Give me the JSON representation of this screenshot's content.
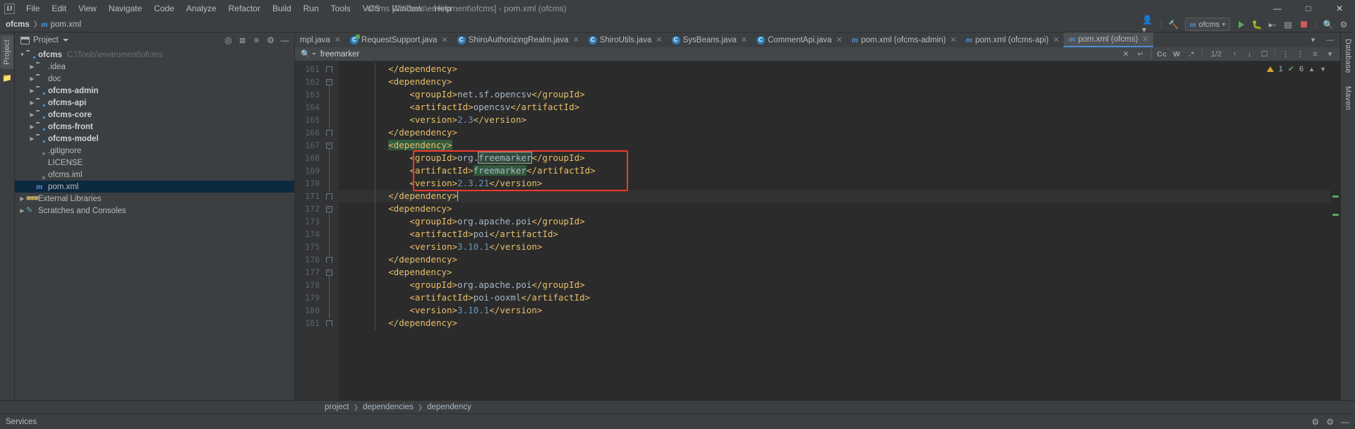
{
  "titlebar": {
    "logo": "IJ",
    "window_title": "ofcms [C:\\Tools\\enviroment\\ofcms] - pom.xml (ofcms)",
    "menu": [
      {
        "label": "File"
      },
      {
        "label": "Edit"
      },
      {
        "label": "View"
      },
      {
        "label": "Navigate"
      },
      {
        "label": "Code"
      },
      {
        "label": "Analyze"
      },
      {
        "label": "Refactor"
      },
      {
        "label": "Build"
      },
      {
        "label": "Run"
      },
      {
        "label": "Tools"
      },
      {
        "label": "VCS"
      },
      {
        "label": "Window"
      },
      {
        "label": "Help"
      }
    ],
    "window_controls": {
      "minimize": "—",
      "maximize": "□",
      "close": "✕"
    }
  },
  "navbar": {
    "breadcrumb": [
      {
        "label": "ofcms",
        "icon": "project-icon"
      },
      {
        "label": "pom.xml",
        "icon": "maven-file-icon"
      }
    ],
    "run_config": "ofcms",
    "icons": [
      "account-icon",
      "hammer-build-icon",
      "run-icon",
      "debug-icon",
      "run-with-coverage-icon",
      "profile-icon",
      "stop-icon",
      "search-everywhere-icon",
      "settings-icon"
    ]
  },
  "left_rail": {
    "tab": "Project",
    "icon": "structure-icon"
  },
  "project_panel": {
    "header": {
      "title": "Project",
      "icons": [
        "locate-icon",
        "collapse-all-icon",
        "expand-icon",
        "settings-icon",
        "hide-icon"
      ]
    },
    "tree": [
      {
        "label": "ofcms",
        "path": "C:\\Tools\\enviroment\\ofcms",
        "icon": "module-folder-icon",
        "indent": 0,
        "arrow": "expanded",
        "bold": true,
        "selected": false
      },
      {
        "label": ".idea",
        "path": "",
        "icon": "folder-icon",
        "indent": 1,
        "arrow": "collapsed",
        "bold": false,
        "selected": false
      },
      {
        "label": "doc",
        "path": "",
        "icon": "folder-icon",
        "indent": 1,
        "arrow": "collapsed",
        "bold": false,
        "selected": false
      },
      {
        "label": "ofcms-admin",
        "path": "",
        "icon": "module-folder-icon",
        "indent": 1,
        "arrow": "collapsed",
        "bold": true,
        "selected": false
      },
      {
        "label": "ofcms-api",
        "path": "",
        "icon": "module-folder-icon",
        "indent": 1,
        "arrow": "collapsed",
        "bold": true,
        "selected": false
      },
      {
        "label": "ofcms-core",
        "path": "",
        "icon": "module-folder-icon",
        "indent": 1,
        "arrow": "collapsed",
        "bold": true,
        "selected": false
      },
      {
        "label": "ofcms-front",
        "path": "",
        "icon": "module-folder-icon",
        "indent": 1,
        "arrow": "collapsed",
        "bold": true,
        "selected": false
      },
      {
        "label": "ofcms-model",
        "path": "",
        "icon": "module-folder-icon",
        "indent": 1,
        "arrow": "collapsed",
        "bold": true,
        "selected": false
      },
      {
        "label": ".gitignore",
        "path": "",
        "icon": "gitignore-file-icon",
        "indent": 1,
        "arrow": "none",
        "bold": false,
        "selected": false
      },
      {
        "label": "LICENSE",
        "path": "",
        "icon": "text-file-icon",
        "indent": 1,
        "arrow": "none",
        "bold": false,
        "selected": false
      },
      {
        "label": "ofcms.iml",
        "path": "",
        "icon": "iml-file-icon",
        "indent": 1,
        "arrow": "none",
        "bold": false,
        "selected": false
      },
      {
        "label": "pom.xml",
        "path": "",
        "icon": "maven-file-icon",
        "indent": 1,
        "arrow": "none",
        "bold": false,
        "selected": true
      },
      {
        "label": "External Libraries",
        "path": "",
        "icon": "libraries-icon",
        "indent": 0,
        "arrow": "collapsed",
        "bold": false,
        "selected": false
      },
      {
        "label": "Scratches and Consoles",
        "path": "",
        "icon": "scratches-icon",
        "indent": 0,
        "arrow": "collapsed",
        "bold": false,
        "selected": false
      }
    ]
  },
  "editor": {
    "tabs": [
      {
        "label": "mpl.java",
        "icon": "java-class-icon",
        "active": false,
        "clipped": true
      },
      {
        "label": "RequestSupport.java",
        "icon": "java-class-run-icon",
        "active": false,
        "clipped": false
      },
      {
        "label": "ShiroAuthorizingRealm.java",
        "icon": "java-class-icon",
        "active": false,
        "clipped": false
      },
      {
        "label": "ShiroUtils.java",
        "icon": "java-class-icon",
        "active": false,
        "clipped": false
      },
      {
        "label": "SysBeans.java",
        "icon": "java-class-icon",
        "active": false,
        "clipped": false
      },
      {
        "label": "CommentApi.java",
        "icon": "java-class-icon",
        "active": false,
        "clipped": false
      },
      {
        "label": "pom.xml (ofcms-admin)",
        "icon": "maven-file-icon",
        "active": false,
        "clipped": false
      },
      {
        "label": "pom.xml (ofcms-api)",
        "icon": "maven-file-icon",
        "active": false,
        "clipped": false
      },
      {
        "label": "pom.xml (ofcms)",
        "icon": "maven-file-icon",
        "active": true,
        "clipped": false
      }
    ],
    "find_bar": {
      "query": "freemarker",
      "placeholder": "Search",
      "match_count": "1/2",
      "buttons": [
        "close-search-icon",
        "multiline-icon",
        "match-case-icon",
        "words-icon",
        "regex-icon"
      ],
      "labels": {
        "match_case": "Cc",
        "words": "W",
        "regex": ".*"
      },
      "nav": [
        "prev-match-icon",
        "next-match-icon",
        "select-all-occurrences-icon",
        "filter-icon"
      ]
    },
    "inspection": {
      "warnings": "1",
      "oks": "6"
    },
    "lines": [
      {
        "num": "161",
        "fold": "end",
        "indent": 2,
        "text": "</dependency>"
      },
      {
        "num": "162",
        "fold": "start",
        "indent": 2,
        "text": "<dependency>"
      },
      {
        "num": "163",
        "fold": "none",
        "indent": 3,
        "text": "<groupId>net.sf.opencsv</groupId>"
      },
      {
        "num": "164",
        "fold": "none",
        "indent": 3,
        "text": "<artifactId>opencsv</artifactId>"
      },
      {
        "num": "165",
        "fold": "none",
        "indent": 3,
        "text": "<version>2.3</version>"
      },
      {
        "num": "166",
        "fold": "end",
        "indent": 2,
        "text": "</dependency>"
      },
      {
        "num": "167",
        "fold": "start",
        "indent": 2,
        "text": "<dependency>"
      },
      {
        "num": "168",
        "fold": "none",
        "indent": 3,
        "text": "<groupId>org.freemarker</groupId>"
      },
      {
        "num": "169",
        "fold": "none",
        "indent": 3,
        "text": "<artifactId>freemarker</artifactId>"
      },
      {
        "num": "170",
        "fold": "none",
        "indent": 3,
        "text": "<version>2.3.21</version>"
      },
      {
        "num": "171",
        "fold": "end",
        "indent": 2,
        "text": "</dependency>"
      },
      {
        "num": "172",
        "fold": "start",
        "indent": 2,
        "text": "<dependency>"
      },
      {
        "num": "173",
        "fold": "none",
        "indent": 3,
        "text": "<groupId>org.apache.poi</groupId>"
      },
      {
        "num": "174",
        "fold": "none",
        "indent": 3,
        "text": "<artifactId>poi</artifactId>"
      },
      {
        "num": "175",
        "fold": "none",
        "indent": 3,
        "text": "<version>3.10.1</version>"
      },
      {
        "num": "176",
        "fold": "end",
        "indent": 2,
        "text": "</dependency>"
      },
      {
        "num": "177",
        "fold": "start",
        "indent": 2,
        "text": "<dependency>"
      },
      {
        "num": "178",
        "fold": "none",
        "indent": 3,
        "text": "<groupId>org.apache.poi</groupId>"
      },
      {
        "num": "179",
        "fold": "none",
        "indent": 3,
        "text": "<artifactId>poi-ooxml</artifactId>"
      },
      {
        "num": "180",
        "fold": "none",
        "indent": 3,
        "text": "<version>3.10.1</version>"
      },
      {
        "num": "181",
        "fold": "end",
        "indent": 2,
        "text": "</dependency>"
      }
    ],
    "annotation": {
      "type": "red-rectangle",
      "color": "#f2392c"
    }
  },
  "right_rail": {
    "tabs": [
      "Database",
      "Maven"
    ]
  },
  "bottom": {
    "breadcrumb": [
      "project",
      "dependencies",
      "dependency"
    ],
    "status_left": "Services",
    "status_icons": [
      "event-log-icon",
      "settings-icon",
      "hide-icon"
    ]
  }
}
